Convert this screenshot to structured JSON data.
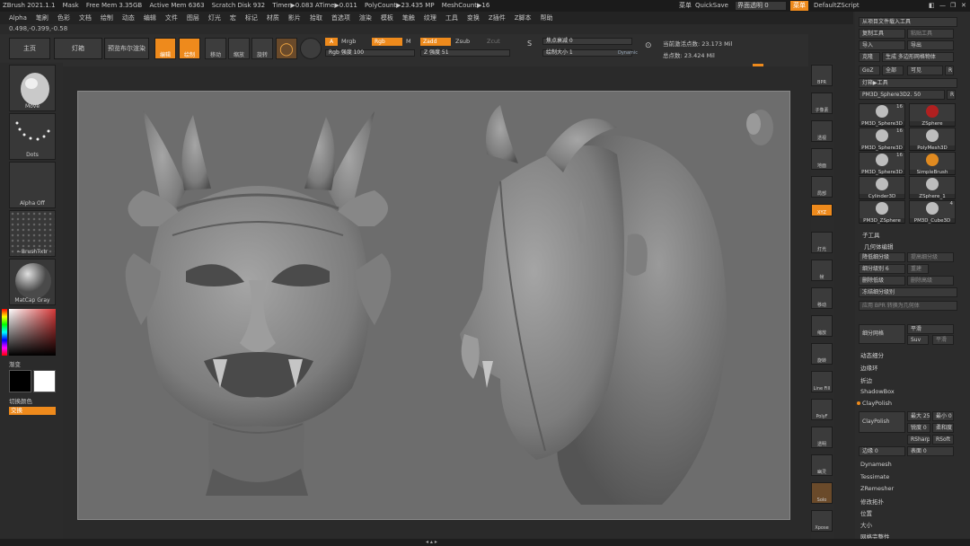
{
  "titlebar": {
    "app": "ZBrush 2021.1.1",
    "mask": "Mask",
    "free_mem": "Free Mem 3.35GB",
    "active_mem": "Active Mem 6363",
    "scratch": "Scratch Disk 932",
    "timer": "Timer▶0.083 ATime▶0.011",
    "polycount": "PolyCount▶23.435 MP",
    "meshcount": "MeshCount▶16"
  },
  "topright": {
    "hint": "菜单",
    "quicksave": "QuickSave",
    "transparency": "界面透明 0",
    "menu_btn": "菜单",
    "script": "DefaultZScript"
  },
  "menubar": [
    "Alpha",
    "笔刷",
    "色彩",
    "文档",
    "绘制",
    "动态",
    "编辑",
    "文件",
    "图层",
    "灯光",
    "宏",
    "标记",
    "材质",
    "影片",
    "拾取",
    "首选项",
    "渲染",
    "模板",
    "笔触",
    "纹理",
    "工具",
    "变换",
    "Z插件",
    "Z脚本",
    "帮助"
  ],
  "coords": "0.498,-0.399,-0.58",
  "toolbar": {
    "home": "主页",
    "lightbox": "灯箱",
    "preview": "预览布尔渲染",
    "edit": "编辑",
    "draw": "绘制",
    "move": "移动",
    "scale": "缩放",
    "rotate": "旋转",
    "a": "A",
    "mrgb": "Mrgb",
    "rgb": "Rgb",
    "m": "M",
    "zadd": "Zadd",
    "zsub": "Zsub",
    "zcut": "Zcut",
    "rgb_intensity": "Rgb 强度 100",
    "z_intensity": "Z 强度 51",
    "focal_shift": "焦点衰减 0",
    "draw_size": "绘制大小 1",
    "dynamic": "Dynamic",
    "active_points": "当前激活点数: 23.173 Mil",
    "total_points": "总点数: 23.424 Mil"
  },
  "leftpanel": {
    "move": "Move",
    "dots": "Dots",
    "alpha_off": "Alpha Off",
    "brush_txtr": "~BrushTxtr",
    "matcap": "MatCap Gray",
    "gradient": "渐变",
    "switch_color": "切换颜色",
    "alternate": "交换"
  },
  "vshelf": [
    "BPR",
    "子像素",
    "透视",
    "地面",
    "局部",
    "XYZ",
    "灯光",
    "帧",
    "移动",
    "缩放",
    "旋转",
    "Line Fill",
    "PolyF",
    "透明",
    "幽灵",
    "Solo",
    "Xpose"
  ],
  "rpanel": {
    "load_from_file": "从项目文件载入工具",
    "copy_tool": "复制工具",
    "paste_tool": "粘贴工具",
    "import": "导入",
    "export": "导出",
    "clone": "克隆",
    "make_polymesh": "生成 多边形网格物体",
    "goz": "GoZ",
    "all": "全部",
    "visible": "可见",
    "r": "R",
    "lightbox_tools": "灯箱▶工具",
    "current_tool": "PM3D_Sphere3D2. 50",
    "tools": [
      {
        "name": "PM3D_Sphere3D",
        "count": "16"
      },
      {
        "name": "ZSphere",
        "count": ""
      },
      {
        "name": "PM3D_Sphere3D",
        "count": "16"
      },
      {
        "name": "PolyMesh3D",
        "count": ""
      },
      {
        "name": "PM3D_Sphere3D",
        "count": "16"
      },
      {
        "name": "SimpleBrush",
        "count": ""
      },
      {
        "name": "Cylinder3D",
        "count": ""
      },
      {
        "name": "ZSphere_1",
        "count": ""
      },
      {
        "name": "PM3D_ZSphere",
        "count": ""
      },
      {
        "name": "PM3D_Cube3D",
        "count": "4"
      }
    ],
    "subtool": "子工具",
    "geometry": "几何体编辑",
    "lower_res": "降低细分级",
    "higher_res": "提高细分级",
    "sdiv": "细分级别 6",
    "reconstruct": "重建",
    "del_lower": "删除低级",
    "del_higher": "删除高级",
    "freeze_subdiv": "冻结细分级别",
    "apply_dispmap": "应用 BPR 转换为几何体",
    "divide": "细分网格",
    "smooth": "平滑",
    "suv": "Suv",
    "rsmooth": "平滑",
    "dynamic_subdiv": "动态细分",
    "edge_loop": "边缘环",
    "crease": "折边",
    "shadowbox": "ShadowBox",
    "claypolish": "ClayPolish",
    "claypolish_btn": "ClayPolish",
    "max_25": "最大 25",
    "min_0": "最小 0",
    "sharp_0": "锐度 0",
    "soften": "柔和度",
    "rsharp": "RSharp",
    "rsoft": "RSoft",
    "edge_0": "边缘 0",
    "surface_0": "表面 0",
    "dynamesh": "Dynamesh",
    "tessimate": "Tessimate",
    "zremesher": "ZRemesher",
    "modify_topo": "修改拓扑",
    "position": "位置",
    "size": "大小",
    "mesh_integrity": "网格完整性"
  },
  "colors": {
    "accent": "#ee8a1c",
    "viewport_bg": "#6d6d6d",
    "mesh": "#8a8a8a"
  }
}
